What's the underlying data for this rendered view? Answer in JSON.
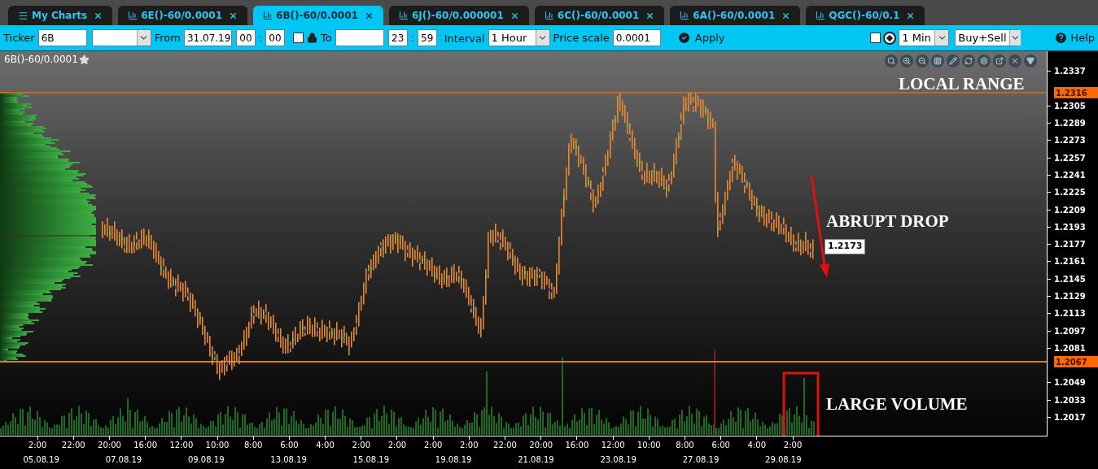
{
  "tabs": [
    {
      "label": "My Charts",
      "kind": "menu",
      "selected": false
    },
    {
      "label": "6E()-60/0.0001",
      "kind": "chart",
      "selected": false
    },
    {
      "label": "6B()-60/0.0001",
      "kind": "chart",
      "selected": true
    },
    {
      "label": "6J()-60/0.000001",
      "kind": "chart",
      "selected": false
    },
    {
      "label": "6C()-60/0.0001",
      "kind": "chart",
      "selected": false
    },
    {
      "label": "6A()-60/0.0001",
      "kind": "chart",
      "selected": false
    },
    {
      "label": "QGC()-60/0.1",
      "kind": "chart",
      "selected": false
    }
  ],
  "toolbar": {
    "ticker_label": "Ticker",
    "ticker": "6B",
    "from_label": "From",
    "from_date": "31.07.19",
    "from_hour": "00",
    "from_separator": ":",
    "from_minute": "00",
    "lock_checked": false,
    "to_label": "To",
    "to_hour": "23",
    "to_separator": ":",
    "to_minute": "59",
    "interval_label": "Interval",
    "interval": "1 Hour",
    "price_scale_label": "Price scale",
    "price_scale": "0.0001",
    "apply": "Apply",
    "auto_checked": false,
    "timeframe": "1 Min",
    "side": "Buy+Sell",
    "help": "Help"
  },
  "chart": {
    "title": "6B()-60/0.0001",
    "y_ticks": [
      "1.2337",
      "1.2305",
      "1.2289",
      "1.2273",
      "1.2257",
      "1.2241",
      "1.2225",
      "1.2209",
      "1.2193",
      "1.2177",
      "1.2161",
      "1.2145",
      "1.2129",
      "1.2113",
      "1.2097",
      "1.2081",
      "1.2049",
      "1.2033",
      "1.2017"
    ],
    "range_high": "1.2316",
    "range_low": "1.2067",
    "last_price": "1.2173",
    "annotations": [
      "LOCAL RANGE",
      "ABRUPT DROP",
      "LARGE VOLUME"
    ],
    "x_times": [
      "2:00",
      "22:00",
      "20:00",
      "16:00",
      "12:00",
      "10:00",
      "8:00",
      "6:00",
      "4:00",
      "2:00",
      "2:00",
      "2:00",
      "2:00",
      "22:00",
      "20:00",
      "16:00",
      "12:00",
      "10:00",
      "8:00",
      "6:00",
      "4:00",
      "2:00"
    ],
    "x_dates": [
      "05.08.19",
      "07.08.19",
      "09.08.19",
      "13.08.19",
      "15.08.19",
      "19.08.19",
      "21.08.19",
      "23.08.19",
      "27.08.19",
      "29.08.19"
    ]
  }
}
